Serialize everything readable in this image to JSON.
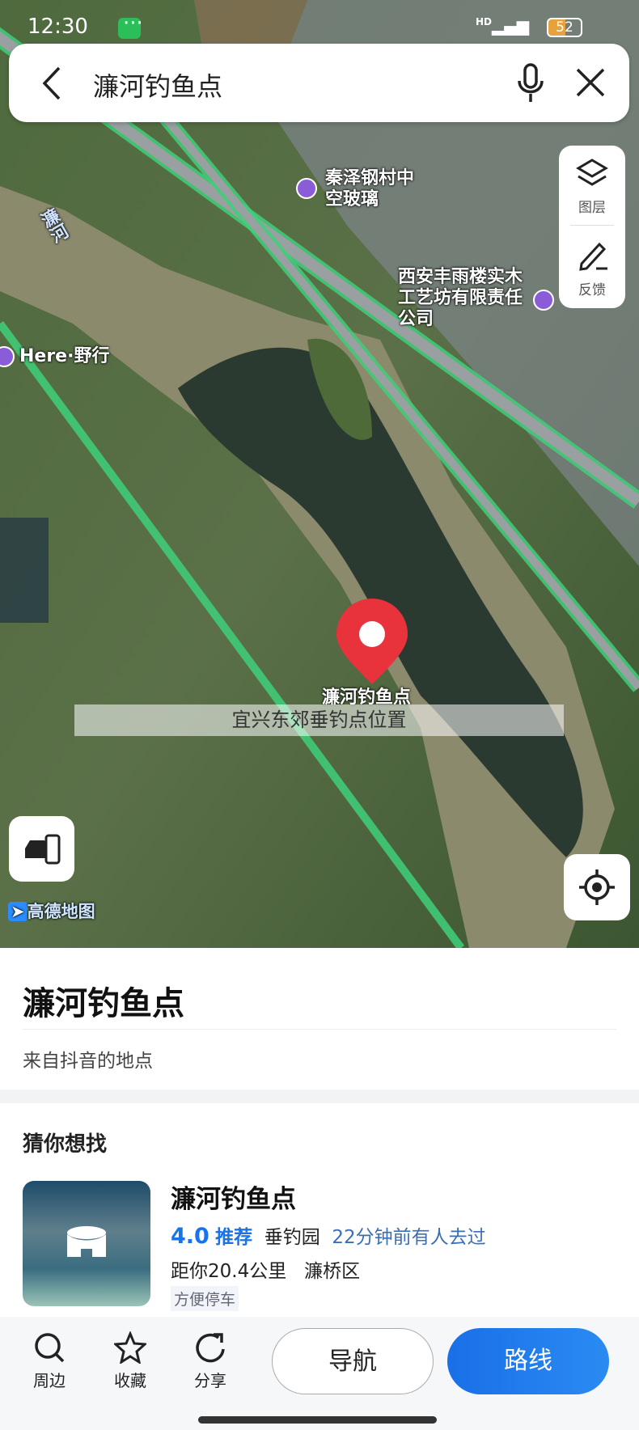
{
  "status_bar": {
    "time": "12:30",
    "battery": "52",
    "network": "HD"
  },
  "search": {
    "query": "濂河钓鱼点",
    "back_icon": "chevron-left-icon",
    "mic_icon": "microphone-icon",
    "clear_icon": "close-icon"
  },
  "map_controls": {
    "layers_label": "图层",
    "feedback_label": "反馈"
  },
  "map_labels": {
    "river": "濂河",
    "poi1": "秦泽钢村中空玻璃",
    "poi2": "西安丰雨楼实木工艺坊有限责任公司",
    "poi3": "Here·野行",
    "pin": "濂河钓鱼点",
    "logo": "高德地图"
  },
  "caption": "宜兴东郊垂钓点位置",
  "place": {
    "title": "濂河钓鱼点",
    "source": "来自抖音的地点"
  },
  "suggest": {
    "heading": "猜你想找",
    "card": {
      "name": "濂河钓鱼点",
      "rating": "4.0",
      "rating_label": "推荐",
      "category": "垂钓园",
      "recent": "22分钟前有人去过",
      "distance": "距你20.4公里",
      "district": "濂桥区",
      "tag": "方便停车"
    }
  },
  "bottom_bar": {
    "nearby": "周边",
    "favorite": "收藏",
    "share": "分享",
    "navigate": "导航",
    "route": "路线"
  },
  "colors": {
    "accent": "#1a73e8",
    "pin": "#e8323c",
    "road": "#3fd07a"
  }
}
